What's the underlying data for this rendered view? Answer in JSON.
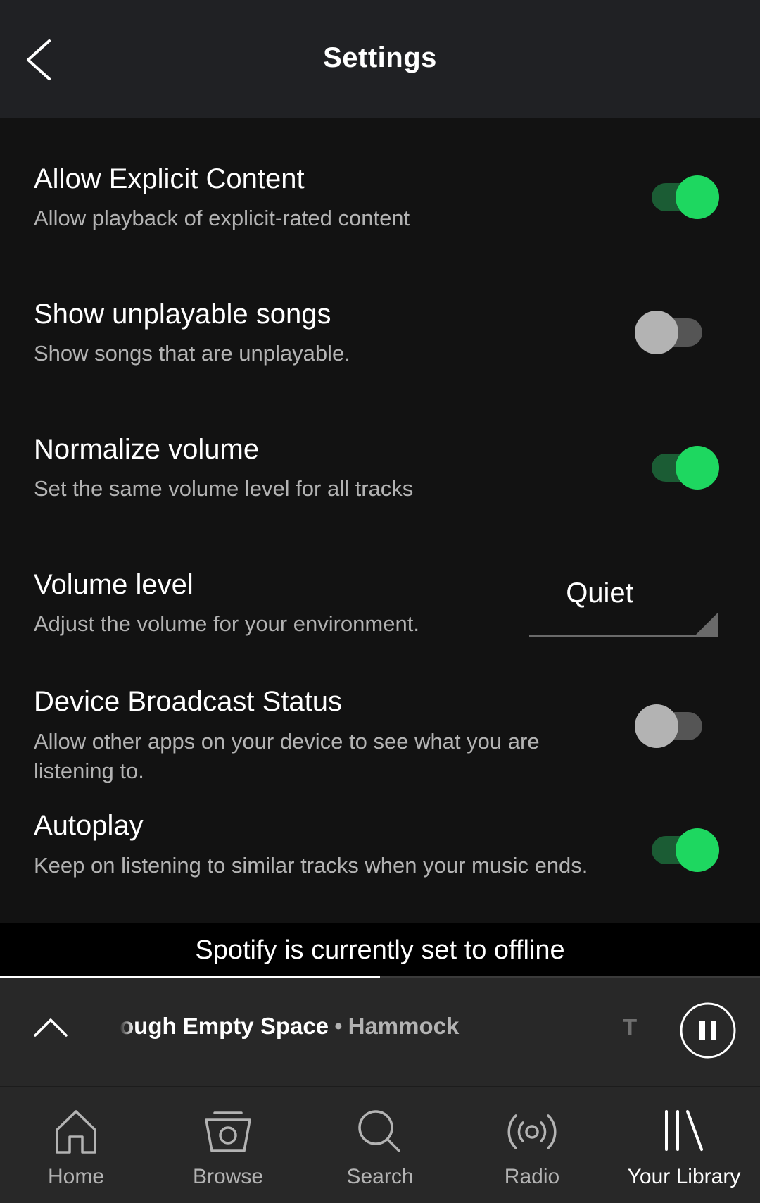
{
  "header": {
    "title": "Settings",
    "back_icon": "chevron-left-icon"
  },
  "settings": {
    "explicit": {
      "title": "Allow Explicit Content",
      "subtitle": "Allow playback of explicit-rated content",
      "enabled": true
    },
    "unplayable": {
      "title": "Show unplayable songs",
      "subtitle": "Show songs that are unplayable.",
      "enabled": false
    },
    "normalize": {
      "title": "Normalize volume",
      "subtitle": "Set the same volume level for all tracks",
      "enabled": true
    },
    "volume_level": {
      "title": "Volume level",
      "subtitle": "Adjust the volume for your environment.",
      "value": "Quiet"
    },
    "broadcast": {
      "title": "Device Broadcast Status",
      "subtitle": "Allow other apps on your device to see what you are listening to.",
      "enabled": false
    },
    "autoplay": {
      "title": "Autoplay",
      "subtitle": "Keep on listening to similar tracks when your music ends.",
      "enabled": true
    }
  },
  "offline_banner": {
    "text": "Spotify is currently set to offline"
  },
  "now_playing": {
    "track": "ough Empty Space",
    "separator": "•",
    "artist": "Hammock",
    "next_preview": "T",
    "progress": 0.5
  },
  "bottom_nav": {
    "items": [
      {
        "label": "Home",
        "icon": "home-icon",
        "active": false
      },
      {
        "label": "Browse",
        "icon": "browse-icon",
        "active": false
      },
      {
        "label": "Search",
        "icon": "search-icon",
        "active": false
      },
      {
        "label": "Radio",
        "icon": "radio-icon",
        "active": false
      },
      {
        "label": "Your Library",
        "icon": "library-icon",
        "active": true
      }
    ]
  },
  "colors": {
    "accent": "#1ed760",
    "background": "#121212",
    "header": "#202124"
  }
}
